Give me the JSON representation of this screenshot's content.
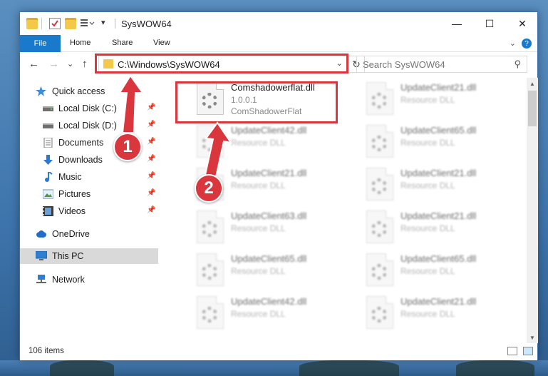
{
  "window": {
    "title": "SysWOW64",
    "minimize": "—",
    "maximize": "☐",
    "close": "✕"
  },
  "ribbon": {
    "tabs": [
      {
        "label": "File"
      },
      {
        "label": "Home"
      },
      {
        "label": "Share"
      },
      {
        "label": "View"
      }
    ],
    "expand_icon": "⌄",
    "help_icon": "?"
  },
  "navigation": {
    "back": "←",
    "forward": "→",
    "recent": "⌄",
    "up": "↑",
    "address": "C:\\Windows\\SysWOW64",
    "address_dropdown": "⌄",
    "refresh": "↻",
    "search_placeholder": "Search SysWOW64",
    "search_icon": "⚲"
  },
  "sidebar": {
    "items": [
      {
        "label": "Quick access",
        "icon": "star-icon",
        "pinned": false
      },
      {
        "label": "Local Disk (C:)",
        "icon": "drive-icon",
        "pinned": true
      },
      {
        "label": "Local Disk (D:)",
        "icon": "drive-icon",
        "pinned": true
      },
      {
        "label": "Documents",
        "icon": "documents-icon",
        "pinned": true
      },
      {
        "label": "Downloads",
        "icon": "download-icon",
        "pinned": true
      },
      {
        "label": "Music",
        "icon": "music-icon",
        "pinned": true
      },
      {
        "label": "Pictures",
        "icon": "pictures-icon",
        "pinned": true
      },
      {
        "label": "Videos",
        "icon": "videos-icon",
        "pinned": true
      },
      {
        "label": "OneDrive",
        "icon": "cloud-icon",
        "pinned": false
      },
      {
        "label": "This PC",
        "icon": "computer-icon",
        "pinned": false
      },
      {
        "label": "Network",
        "icon": "network-icon",
        "pinned": false
      }
    ],
    "pin_glyph": "📌"
  },
  "files": [
    {
      "name": "Comshadowerflat.dll",
      "line1": "1.0.0.1",
      "line2": "ComShadowerFlat",
      "highlight": true
    },
    {
      "name": "UpdateClient21.dll",
      "line1": "Resource DLL"
    },
    {
      "name": "UpdateClient42.dll",
      "line1": "Resource DLL"
    },
    {
      "name": "UpdateClient65.dll",
      "line1": "Resource DLL"
    },
    {
      "name": "UpdateClient21.dll",
      "line1": "Resource DLL"
    },
    {
      "name": "UpdateClient21.dll",
      "line1": "Resource DLL"
    },
    {
      "name": "UpdateClient63.dll",
      "line1": "Resource DLL"
    },
    {
      "name": "UpdateClient21.dll",
      "line1": "Resource DLL"
    },
    {
      "name": "UpdateClient65.dll",
      "line1": "Resource DLL"
    },
    {
      "name": "UpdateClient65.dll",
      "line1": "Resource DLL"
    },
    {
      "name": "UpdateClient42.dll",
      "line1": "Resource DLL"
    },
    {
      "name": "UpdateClient21.dll",
      "line1": "Resource DLL"
    }
  ],
  "status": {
    "items_count": "106 items"
  },
  "scrollbar": {
    "up": "▲",
    "down": "▼"
  },
  "markers": [
    {
      "label": "1"
    },
    {
      "label": "2"
    }
  ],
  "colors": {
    "accent": "#1979ca",
    "highlight_red": "#d9363e",
    "selection": "#d9d9d9"
  }
}
